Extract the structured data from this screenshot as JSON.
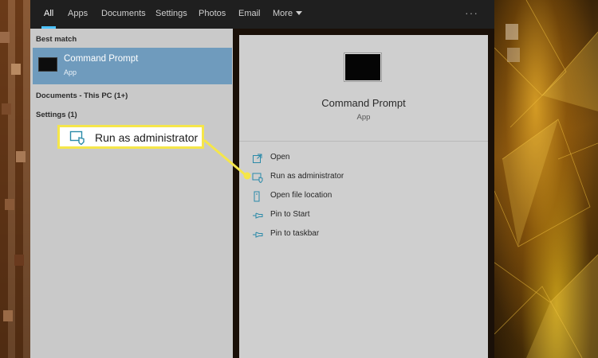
{
  "tabs": [
    {
      "label": "All",
      "active": true
    },
    {
      "label": "Apps",
      "active": false
    },
    {
      "label": "Documents",
      "active": false
    },
    {
      "label": "Settings",
      "active": false
    },
    {
      "label": "Photos",
      "active": false
    },
    {
      "label": "Email",
      "active": false
    },
    {
      "label": "More",
      "active": false
    }
  ],
  "more_options": "···",
  "results": {
    "best_match_label": "Best match",
    "best_match": {
      "title": "Command Prompt",
      "subtitle": "App",
      "icon": "terminal-icon"
    },
    "documents_label": "Documents - This PC (1+)",
    "settings_label": "Settings (1)"
  },
  "preview": {
    "title": "Command Prompt",
    "subtitle": "App",
    "icon": "terminal-icon",
    "actions": [
      {
        "label": "Open",
        "icon": "open-icon"
      },
      {
        "label": "Run as administrator",
        "icon": "admin-shield-icon"
      },
      {
        "label": "Open file location",
        "icon": "file-location-icon"
      },
      {
        "label": "Pin to Start",
        "icon": "pin-icon"
      },
      {
        "label": "Pin to taskbar",
        "icon": "pin-icon"
      }
    ]
  },
  "callout": {
    "label": "Run as administrator",
    "icon": "admin-shield-icon"
  },
  "colors": {
    "accent": "#4cc2ff",
    "highlight": "#6f9bbd",
    "callout_border": "#f5e64a",
    "topbar": "#1f1f1f",
    "pane": "#c9c9c9"
  }
}
